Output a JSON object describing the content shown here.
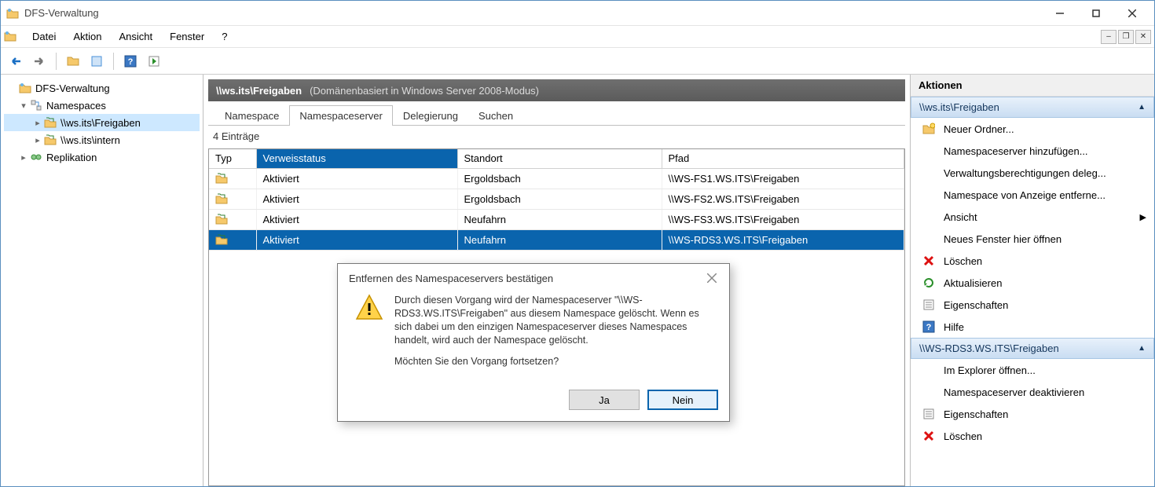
{
  "window": {
    "title": "DFS-Verwaltung"
  },
  "menu": {
    "items": [
      "Datei",
      "Aktion",
      "Ansicht",
      "Fenster",
      "?"
    ]
  },
  "tree": {
    "root": "DFS-Verwaltung",
    "nodes": [
      {
        "label": "Namespaces",
        "indent": 1,
        "expander": "▾"
      },
      {
        "label": "\\\\ws.its\\Freigaben",
        "indent": 2,
        "expander": "▸",
        "selected": true
      },
      {
        "label": "\\\\ws.its\\intern",
        "indent": 2,
        "expander": "▸"
      },
      {
        "label": "Replikation",
        "indent": 1,
        "expander": "▸"
      }
    ]
  },
  "main": {
    "path": "\\\\ws.its\\Freigaben",
    "path_sub": "(Domänenbasiert in Windows Server 2008-Modus)",
    "tabs": [
      "Namespace",
      "Namespaceserver",
      "Delegierung",
      "Suchen"
    ],
    "active_tab_index": 1,
    "entry_count_label": "4 Einträge",
    "columns": [
      "Typ",
      "Verweisstatus",
      "Standort",
      "Pfad"
    ],
    "sorted_col_index": 1,
    "rows": [
      {
        "status": "Aktiviert",
        "site": "Ergoldsbach",
        "path": "\\\\WS-FS1.WS.ITS\\Freigaben"
      },
      {
        "status": "Aktiviert",
        "site": "Ergoldsbach",
        "path": "\\\\WS-FS2.WS.ITS\\Freigaben"
      },
      {
        "status": "Aktiviert",
        "site": "Neufahrn",
        "path": "\\\\WS-FS3.WS.ITS\\Freigaben"
      },
      {
        "status": "Aktiviert",
        "site": "Neufahrn",
        "path": "\\\\WS-RDS3.WS.ITS\\Freigaben",
        "selected": true
      }
    ]
  },
  "dialog": {
    "title": "Entfernen des Namespaceservers bestätigen",
    "body1": "Durch diesen Vorgang wird der Namespaceserver \"\\\\WS-RDS3.WS.ITS\\Freigaben\" aus diesem Namespace gelöscht. Wenn es sich dabei um den einzigen Namespaceserver dieses Namespaces handelt, wird auch der Namespace gelöscht.",
    "body2": "Möchten Sie den Vorgang fortsetzen?",
    "yes": "Ja",
    "no": "Nein"
  },
  "actions": {
    "title": "Aktionen",
    "group1": {
      "header": "\\\\ws.its\\Freigaben",
      "items": [
        {
          "label": "Neuer Ordner...",
          "icon": "folder-new"
        },
        {
          "label": "Namespaceserver hinzufügen...",
          "icon": "blank"
        },
        {
          "label": "Verwaltungsberechtigungen deleg...",
          "icon": "blank"
        },
        {
          "label": "Namespace von Anzeige entferne...",
          "icon": "blank"
        },
        {
          "label": "Ansicht",
          "icon": "blank",
          "chevron": true
        },
        {
          "label": "Neues Fenster hier öffnen",
          "icon": "blank"
        },
        {
          "label": "Löschen",
          "icon": "delete"
        },
        {
          "label": "Aktualisieren",
          "icon": "refresh"
        },
        {
          "label": "Eigenschaften",
          "icon": "props"
        },
        {
          "label": "Hilfe",
          "icon": "help"
        }
      ]
    },
    "group2": {
      "header": "\\\\WS-RDS3.WS.ITS\\Freigaben",
      "items": [
        {
          "label": "Im Explorer öffnen...",
          "icon": "blank"
        },
        {
          "label": "Namespaceserver deaktivieren",
          "icon": "blank"
        },
        {
          "label": "Eigenschaften",
          "icon": "props"
        },
        {
          "label": "Löschen",
          "icon": "delete"
        }
      ]
    }
  }
}
